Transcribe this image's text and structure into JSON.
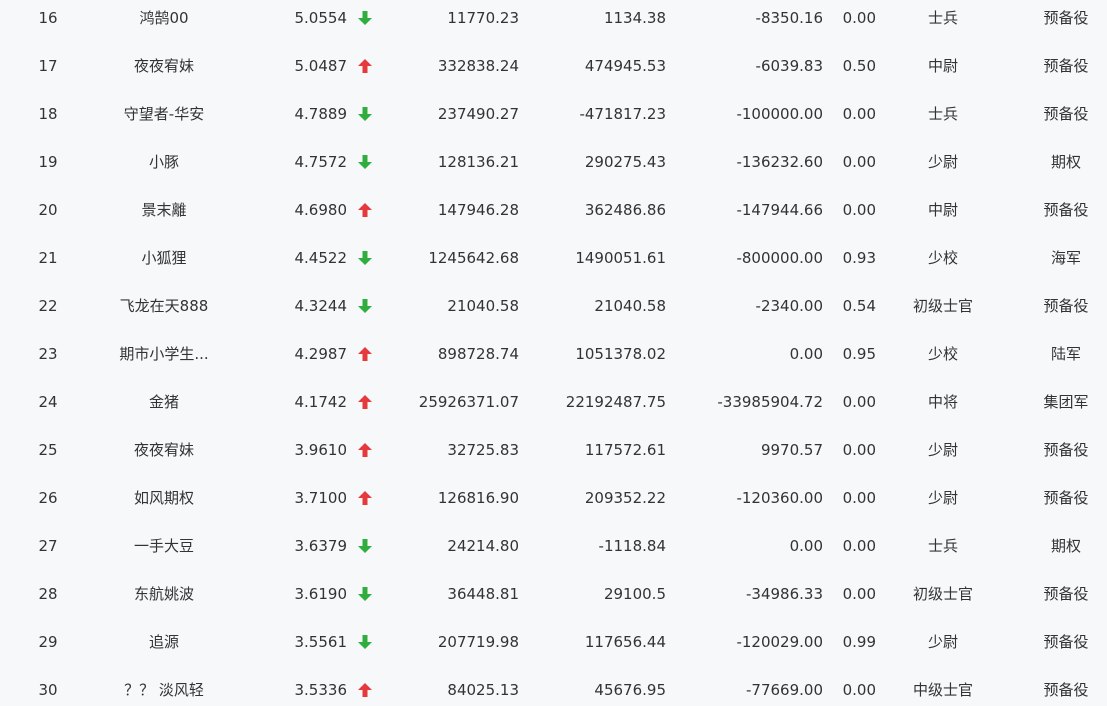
{
  "colors": {
    "up": "#e5393b",
    "down": "#2fae3f",
    "text": "#333333",
    "background": "#f7f8fa"
  },
  "rows": [
    {
      "rank": "16",
      "name": "鸿鹄00",
      "ratio": "5.0554",
      "trend": "down",
      "trend_icon": "arrow-down-icon",
      "v1": "11770.23",
      "v2": "1134.38",
      "v3": "-8350.16",
      "v4": "0.00",
      "title": "士兵",
      "group": "预备役"
    },
    {
      "rank": "17",
      "name": "夜夜宥妹",
      "ratio": "5.0487",
      "trend": "up",
      "trend_icon": "arrow-up-icon",
      "v1": "332838.24",
      "v2": "474945.53",
      "v3": "-6039.83",
      "v4": "0.50",
      "title": "中尉",
      "group": "预备役"
    },
    {
      "rank": "18",
      "name": "守望者-华安",
      "ratio": "4.7889",
      "trend": "down",
      "trend_icon": "arrow-down-icon",
      "v1": "237490.27",
      "v2": "-471817.23",
      "v3": "-100000.00",
      "v4": "0.00",
      "title": "士兵",
      "group": "预备役"
    },
    {
      "rank": "19",
      "name": "小豚",
      "ratio": "4.7572",
      "trend": "down",
      "trend_icon": "arrow-down-icon",
      "v1": "128136.21",
      "v2": "290275.43",
      "v3": "-136232.60",
      "v4": "0.00",
      "title": "少尉",
      "group": "期权"
    },
    {
      "rank": "20",
      "name": "景末離",
      "ratio": "4.6980",
      "trend": "up",
      "trend_icon": "arrow-up-icon",
      "v1": "147946.28",
      "v2": "362486.86",
      "v3": "-147944.66",
      "v4": "0.00",
      "title": "中尉",
      "group": "预备役"
    },
    {
      "rank": "21",
      "name": "小狐狸",
      "ratio": "4.4522",
      "trend": "down",
      "trend_icon": "arrow-down-icon",
      "v1": "1245642.68",
      "v2": "1490051.61",
      "v3": "-800000.00",
      "v4": "0.93",
      "title": "少校",
      "group": "海军"
    },
    {
      "rank": "22",
      "name": "飞龙在天888",
      "ratio": "4.3244",
      "trend": "down",
      "trend_icon": "arrow-down-icon",
      "v1": "21040.58",
      "v2": "21040.58",
      "v3": "-2340.00",
      "v4": "0.54",
      "title": "初级士官",
      "group": "预备役"
    },
    {
      "rank": "23",
      "name": "期市小学生...",
      "ratio": "4.2987",
      "trend": "up",
      "trend_icon": "arrow-up-icon",
      "v1": "898728.74",
      "v2": "1051378.02",
      "v3": "0.00",
      "v4": "0.95",
      "title": "少校",
      "group": "陆军"
    },
    {
      "rank": "24",
      "name": "金猪",
      "ratio": "4.1742",
      "trend": "up",
      "trend_icon": "arrow-up-icon",
      "v1": "25926371.07",
      "v2": "22192487.75",
      "v3": "-33985904.72",
      "v4": "0.00",
      "title": "中将",
      "group": "集团军"
    },
    {
      "rank": "25",
      "name": "夜夜宥妹",
      "ratio": "3.9610",
      "trend": "up",
      "trend_icon": "arrow-up-icon",
      "v1": "32725.83",
      "v2": "117572.61",
      "v3": "9970.57",
      "v4": "0.00",
      "title": "少尉",
      "group": "预备役"
    },
    {
      "rank": "26",
      "name": "如风期权",
      "ratio": "3.7100",
      "trend": "up",
      "trend_icon": "arrow-up-icon",
      "v1": "126816.90",
      "v2": "209352.22",
      "v3": "-120360.00",
      "v4": "0.00",
      "title": "少尉",
      "group": "预备役"
    },
    {
      "rank": "27",
      "name": "一手大豆",
      "ratio": "3.6379",
      "trend": "down",
      "trend_icon": "arrow-down-icon",
      "v1": "24214.80",
      "v2": "-1118.84",
      "v3": "0.00",
      "v4": "0.00",
      "title": "士兵",
      "group": "期权"
    },
    {
      "rank": "28",
      "name": "东航姚波",
      "ratio": "3.6190",
      "trend": "down",
      "trend_icon": "arrow-down-icon",
      "v1": "36448.81",
      "v2": "29100.5",
      "v3": "-34986.33",
      "v4": "0.00",
      "title": "初级士官",
      "group": "预备役"
    },
    {
      "rank": "29",
      "name": "追源",
      "ratio": "3.5561",
      "trend": "down",
      "trend_icon": "arrow-down-icon",
      "v1": "207719.98",
      "v2": "117656.44",
      "v3": "-120029.00",
      "v4": "0.99",
      "title": "少尉",
      "group": "预备役"
    },
    {
      "rank": "30",
      "name": "？？ 淡风轻",
      "ratio": "3.5336",
      "trend": "up",
      "trend_icon": "arrow-up-icon",
      "v1": "84025.13",
      "v2": "45676.95",
      "v3": "-77669.00",
      "v4": "0.00",
      "title": "中级士官",
      "group": "预备役"
    }
  ]
}
